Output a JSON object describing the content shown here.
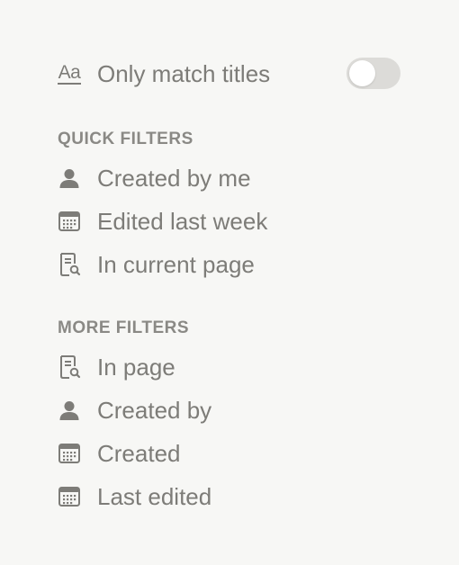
{
  "match_titles": {
    "icon": "text-aa-icon",
    "icon_text": "Aa",
    "label": "Only match titles",
    "toggle_on": false
  },
  "quick_filters": {
    "title": "QUICK FILTERS",
    "items": [
      {
        "icon": "person-icon",
        "label": "Created by me"
      },
      {
        "icon": "calendar-icon",
        "label": "Edited last week"
      },
      {
        "icon": "page-search-icon",
        "label": "In current page"
      }
    ]
  },
  "more_filters": {
    "title": "MORE FILTERS",
    "items": [
      {
        "icon": "page-search-icon",
        "label": "In page"
      },
      {
        "icon": "person-icon",
        "label": "Created by"
      },
      {
        "icon": "calendar-icon",
        "label": "Created"
      },
      {
        "icon": "calendar-icon",
        "label": "Last edited"
      }
    ]
  },
  "colors": {
    "background": "#f7f7f5",
    "text": "#7d7c78",
    "toggle_off": "#dcdbd8"
  }
}
